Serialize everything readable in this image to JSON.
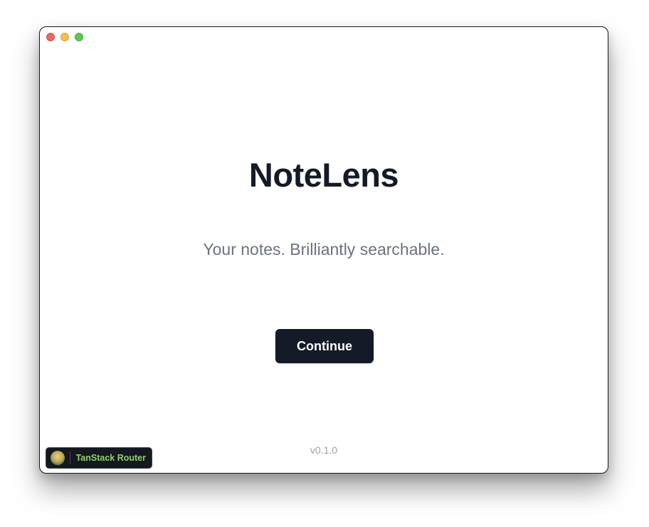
{
  "window": {
    "controls": {
      "close": "close-icon",
      "minimize": "minimize-icon",
      "zoom": "zoom-icon"
    }
  },
  "main": {
    "title": "NoteLens",
    "tagline": "Your notes. Brilliantly searchable.",
    "continue_label": "Continue",
    "version": "v0.1.0"
  },
  "devtools": {
    "label": "TanStack Router",
    "icon": "tanstack-logo-icon"
  },
  "colors": {
    "primary": "#151a28",
    "muted_text": "#6b7280",
    "version_text": "#9aa0a8",
    "badge_bg": "#15181f",
    "badge_text": "#8fd16a",
    "close": "#ec6a5e",
    "minimize": "#f4bf4f",
    "zoom": "#61c554"
  }
}
